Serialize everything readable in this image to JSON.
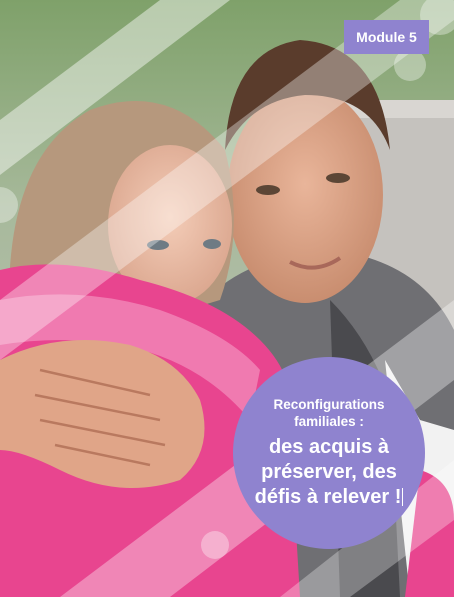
{
  "badge": {
    "label": "Module 5",
    "color": "#8f83cf"
  },
  "title": {
    "subtitle": "Reconfigurations familiales :",
    "main": "des acquis à préserver, des défis à relever !",
    "circle_color": "#8f83cf"
  },
  "colors": {
    "accent_purple": "#8f83cf",
    "pink": "#e8458f",
    "stripe": "#ffffff"
  }
}
